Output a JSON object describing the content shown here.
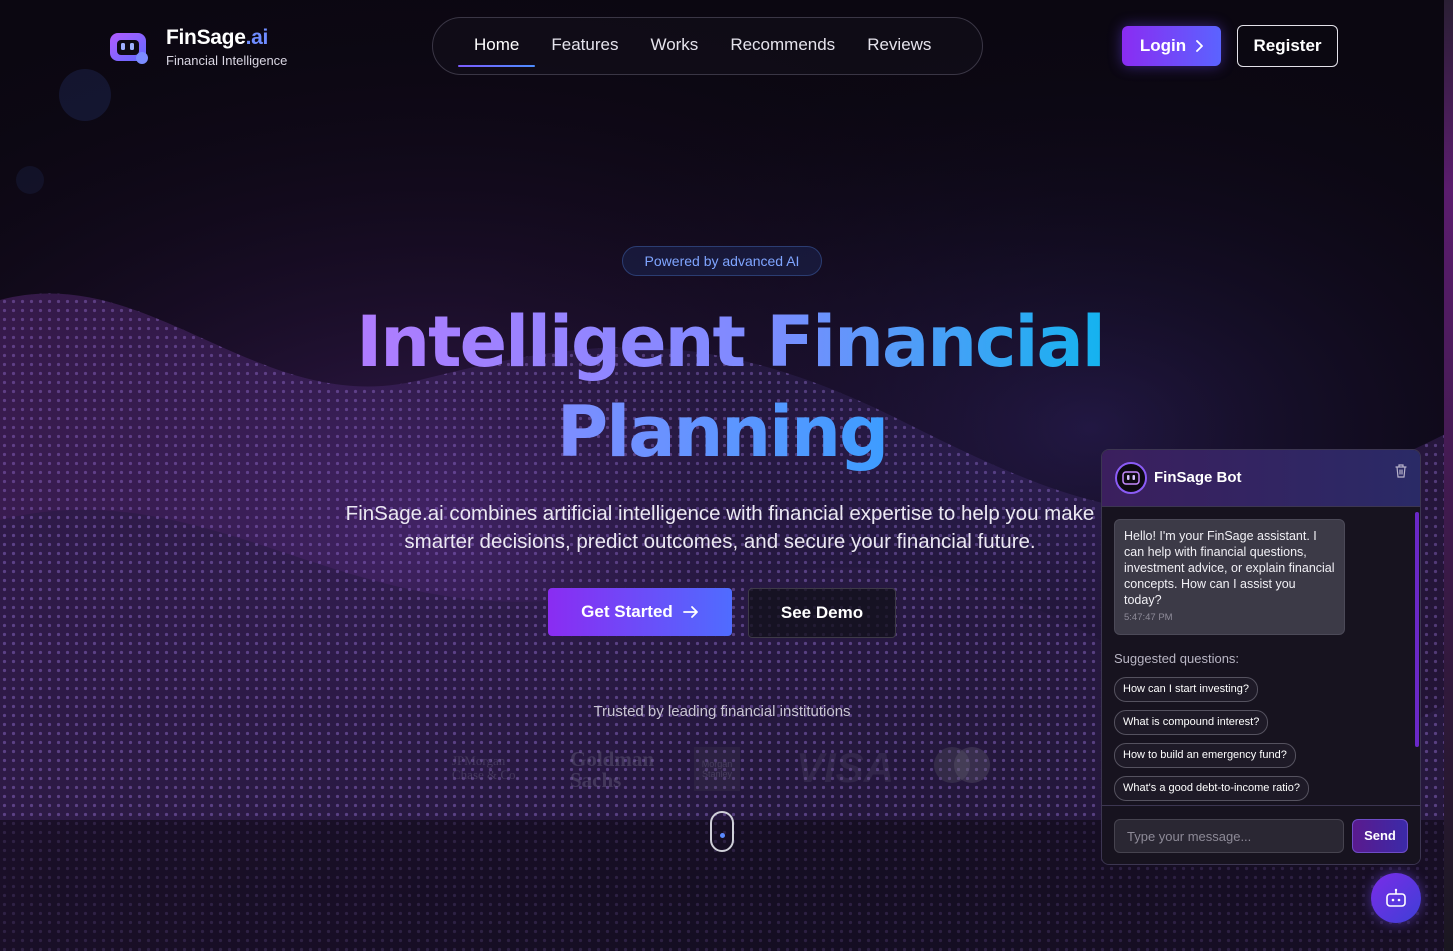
{
  "brand": {
    "name_main": "FinSage",
    "name_suffix": ".ai",
    "tagline": "Financial Intelligence",
    "accent": "#6f8cff"
  },
  "nav": {
    "items": [
      {
        "label": "Home",
        "active": true
      },
      {
        "label": "Features",
        "active": false
      },
      {
        "label": "Works",
        "active": false
      },
      {
        "label": "Recommends",
        "active": false
      },
      {
        "label": "Reviews",
        "active": false
      }
    ],
    "login_label": "Login",
    "register_label": "Register"
  },
  "hero": {
    "badge": "Powered by advanced AI",
    "title_line1_a": "Intelligent",
    "title_line1_b": "Financial",
    "title_line2": "Planning",
    "description": "FinSage.ai combines artificial intelligence with financial expertise to help you make smarter decisions, predict outcomes, and secure your financial future.",
    "primary_cta": "Get Started",
    "secondary_cta": "See Demo",
    "trusted_text": "Trusted by leading financial institutions",
    "partners": {
      "jpmorgan": "JPMorgan Chase & Co.",
      "goldman": "Goldman Sachs",
      "morgan_stanley": "Morgan Stanley",
      "visa": "VISA",
      "mastercard": "mastercard"
    }
  },
  "chatbot": {
    "title": "FinSage Bot",
    "bot_message": "Hello! I'm your FinSage assistant. I can help with financial questions, investment advice, or explain financial concepts. How can I assist you today?",
    "bot_message_time": "5:47:47 PM",
    "suggested_label": "Suggested questions:",
    "suggestions": [
      "How can I start investing?",
      "What is compound interest?",
      "How to build an emergency fund?",
      "What's a good debt-to-income ratio?"
    ],
    "input_placeholder": "Type your message...",
    "send_label": "Send"
  },
  "icons": {
    "logo": "robot-logo-icon",
    "login_chevron": "chevron-right-icon",
    "cta_arrow": "arrow-right-icon",
    "trash": "trash-icon",
    "fab": "robot-chat-icon",
    "scroll": "mouse-scroll-icon"
  },
  "colors": {
    "gradient_purple": "#9f6bff",
    "gradient_blue": "#1fa9f0",
    "primary_button": "#8a2cf2"
  }
}
